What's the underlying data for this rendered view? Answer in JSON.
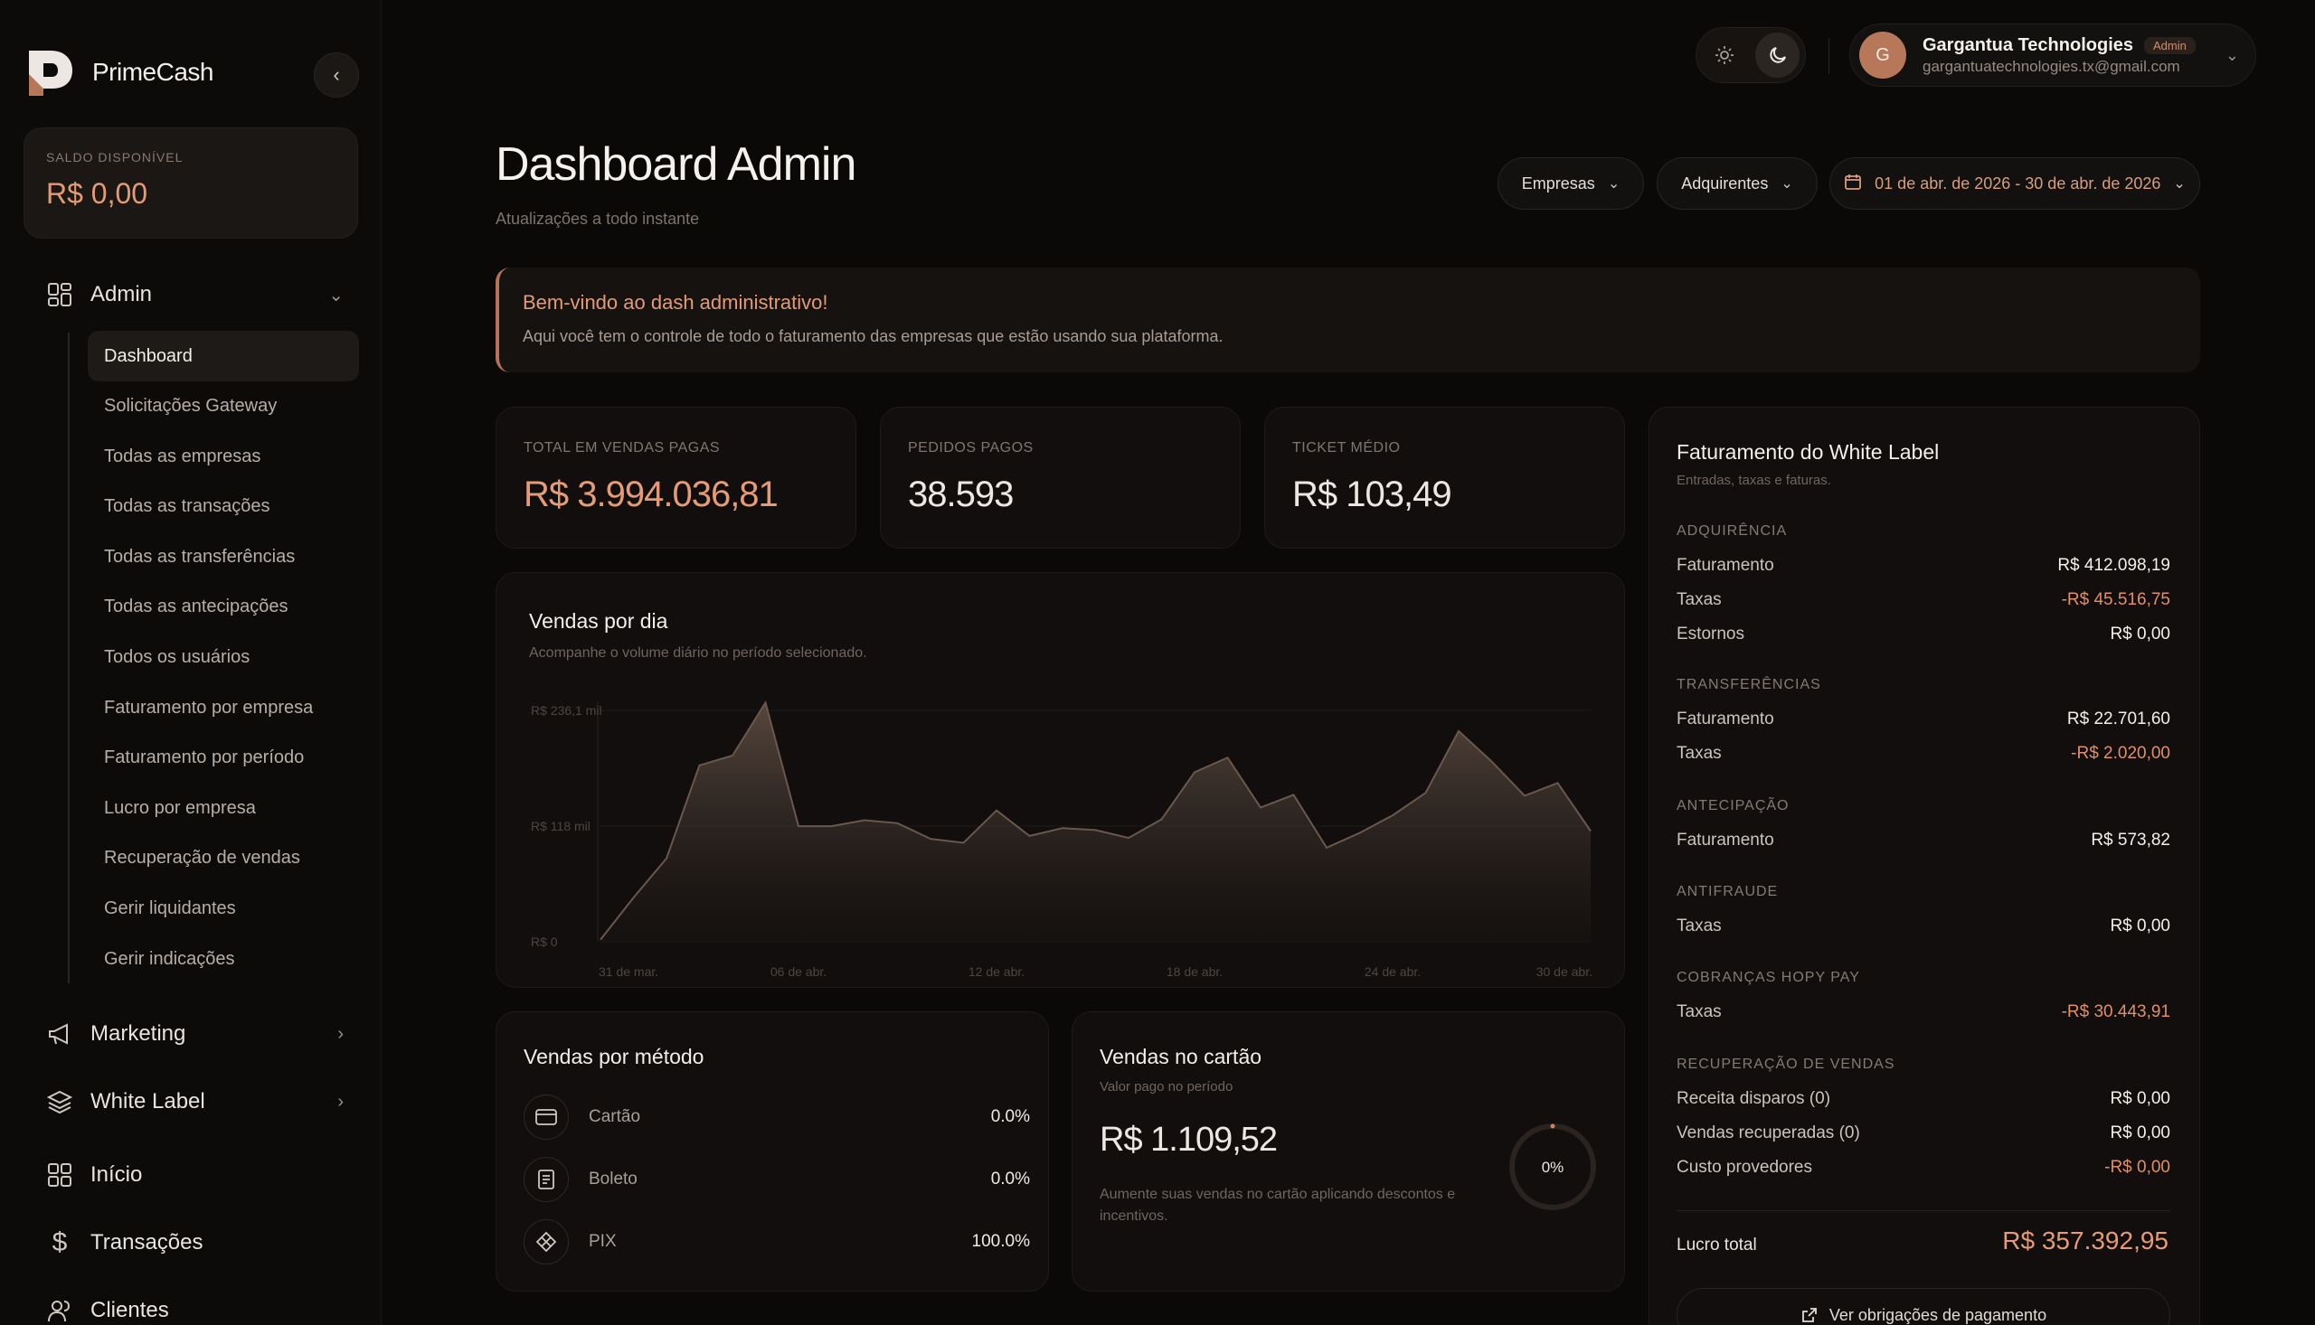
{
  "app": {
    "name": "PrimeCash"
  },
  "sidebar": {
    "balance_label": "SALDO DISPONÍVEL",
    "balance_value": "R$ 0,00",
    "admin_label": "Admin",
    "admin_items": [
      {
        "label": "Dashboard"
      },
      {
        "label": "Solicitações Gateway"
      },
      {
        "label": "Todas as empresas"
      },
      {
        "label": "Todas as transações"
      },
      {
        "label": "Todas as transferências"
      },
      {
        "label": "Todas as antecipações"
      },
      {
        "label": "Todos os usuários"
      },
      {
        "label": "Faturamento por empresa"
      },
      {
        "label": "Faturamento por período"
      },
      {
        "label": "Lucro por empresa"
      },
      {
        "label": "Recuperação de vendas"
      },
      {
        "label": "Gerir liquidantes"
      },
      {
        "label": "Gerir indicações"
      }
    ],
    "sections": [
      {
        "label": "Marketing"
      },
      {
        "label": "White Label"
      },
      {
        "label": "Início"
      },
      {
        "label": "Transações"
      },
      {
        "label": "Clientes"
      }
    ]
  },
  "topbar": {
    "user_initial": "G",
    "user_name": "Gargantua Technologies",
    "user_role": "Admin",
    "user_email": "gargantuatechnologies.tx@gmail.com"
  },
  "header": {
    "title": "Dashboard Admin",
    "subtitle": "Atualizações a todo instante",
    "filter_companies": "Empresas",
    "filter_acquirers": "Adquirentes",
    "filter_date": "01 de abr. de 2026 - 30 de abr. de 2026"
  },
  "welcome": {
    "title": "Bem-vindo ao dash administrativo!",
    "text": "Aqui você tem o controle de todo o faturamento das empresas que estão usando sua plataforma."
  },
  "kpis": [
    {
      "label": "TOTAL EM VENDAS PAGAS",
      "value": "R$ 3.994.036,81"
    },
    {
      "label": "PEDIDOS PAGOS",
      "value": "38.593"
    },
    {
      "label": "TICKET MÉDIO",
      "value": "R$ 103,49"
    }
  ],
  "sales_chart": {
    "title": "Vendas por dia",
    "subtitle": "Acompanhe o volume diário no período selecionado.",
    "y_ticks": [
      "R$ 236,1 mil",
      "R$ 118 mil",
      "R$ 0"
    ],
    "x_ticks": [
      "31 de mar.",
      "06 de abr.",
      "12 de abr.",
      "18 de abr.",
      "24 de abr.",
      "30 de abr."
    ]
  },
  "chart_data": {
    "type": "area",
    "title": "Vendas por dia",
    "ylim": [
      0,
      236100
    ],
    "x": [
      "31 de mar.",
      "01 de abr.",
      "02 de abr.",
      "03 de abr.",
      "04 de abr.",
      "05 de abr.",
      "06 de abr.",
      "07 de abr.",
      "08 de abr.",
      "09 de abr.",
      "10 de abr.",
      "11 de abr.",
      "12 de abr.",
      "13 de abr.",
      "14 de abr.",
      "15 de abr.",
      "16 de abr.",
      "17 de abr.",
      "18 de abr.",
      "19 de abr.",
      "20 de abr.",
      "21 de abr.",
      "22 de abr.",
      "23 de abr.",
      "24 de abr.",
      "25 de abr.",
      "26 de abr.",
      "27 de abr.",
      "28 de abr.",
      "29 de abr.",
      "30 de abr."
    ],
    "values": [
      2000,
      45000,
      85000,
      180000,
      190000,
      244000,
      118000,
      118000,
      124000,
      121000,
      105000,
      101000,
      134000,
      108000,
      116000,
      114000,
      106000,
      125000,
      173000,
      188000,
      137000,
      150000,
      96000,
      111000,
      129000,
      152000,
      215000,
      184000,
      149000,
      162000,
      113000
    ]
  },
  "methods_card": {
    "title": "Vendas por método",
    "rows": [
      {
        "label": "Cartão",
        "value": "0.0%",
        "icon": "card-icon"
      },
      {
        "label": "Boleto",
        "value": "0.0%",
        "icon": "boleto-icon"
      },
      {
        "label": "PIX",
        "value": "100.0%",
        "icon": "pix-icon"
      }
    ]
  },
  "card_sales": {
    "title": "Vendas no cartão",
    "subtitle": "Valor pago no período",
    "amount": "R$ 1.109,52",
    "hint": "Aumente suas vendas no cartão aplicando descontos e incentivos.",
    "percent_label": "0%",
    "percent": 0
  },
  "white_label": {
    "title": "Faturamento do White Label",
    "subtitle": "Entradas, taxas e faturas.",
    "sections": [
      {
        "name": "ADQUIRÊNCIA",
        "rows": [
          {
            "label": "Faturamento",
            "value": "R$ 412.098,19"
          },
          {
            "label": "Taxas",
            "value": "-R$ 45.516,75"
          },
          {
            "label": "Estornos",
            "value": "R$ 0,00"
          }
        ]
      },
      {
        "name": "TRANSFERÊNCIAS",
        "rows": [
          {
            "label": "Faturamento",
            "value": "R$ 22.701,60"
          },
          {
            "label": "Taxas",
            "value": "-R$ 2.020,00"
          }
        ]
      },
      {
        "name": "ANTECIPAÇÃO",
        "rows": [
          {
            "label": "Faturamento",
            "value": "R$ 573,82"
          }
        ]
      },
      {
        "name": "ANTIFRAUDE",
        "rows": [
          {
            "label": "Taxas",
            "value": "R$ 0,00"
          }
        ]
      },
      {
        "name": "COBRANÇAS HOPY PAY",
        "rows": [
          {
            "label": "Taxas",
            "value": "-R$ 30.443,91"
          }
        ]
      },
      {
        "name": "RECUPERAÇÃO DE VENDAS",
        "rows": [
          {
            "label": "Receita disparos (0)",
            "value": "R$ 0,00"
          },
          {
            "label": "Vendas recuperadas (0)",
            "value": "R$ 0,00"
          },
          {
            "label": "Custo provedores",
            "value": "-R$ 0,00"
          }
        ]
      }
    ],
    "total_label": "Lucro total",
    "total_value": "R$ 357.392,95",
    "button_label": "Ver obrigações de pagamento"
  },
  "colors": {
    "accent": "#e59c76",
    "background": "#0b0908",
    "card": "#110e0d"
  }
}
